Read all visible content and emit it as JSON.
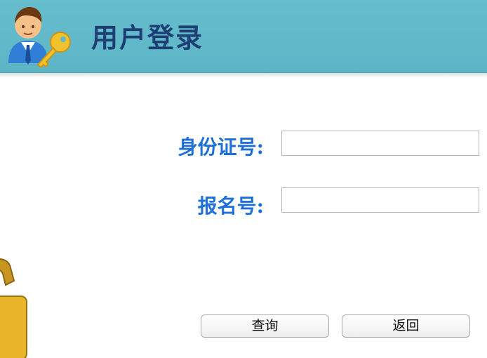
{
  "header": {
    "title": "用户登录",
    "icon": "user-key-icon",
    "background_color": "#62b9c9",
    "title_color": "#1d3f73"
  },
  "form": {
    "id_number_label": "身份证号:",
    "id_number_value": "",
    "registration_label": "报名号:",
    "registration_value": "",
    "label_color": "#1f6fd9"
  },
  "actions": {
    "query_label": "查询",
    "back_label": "返回"
  },
  "decor": {
    "padlock_icon": "padlock-icon"
  }
}
